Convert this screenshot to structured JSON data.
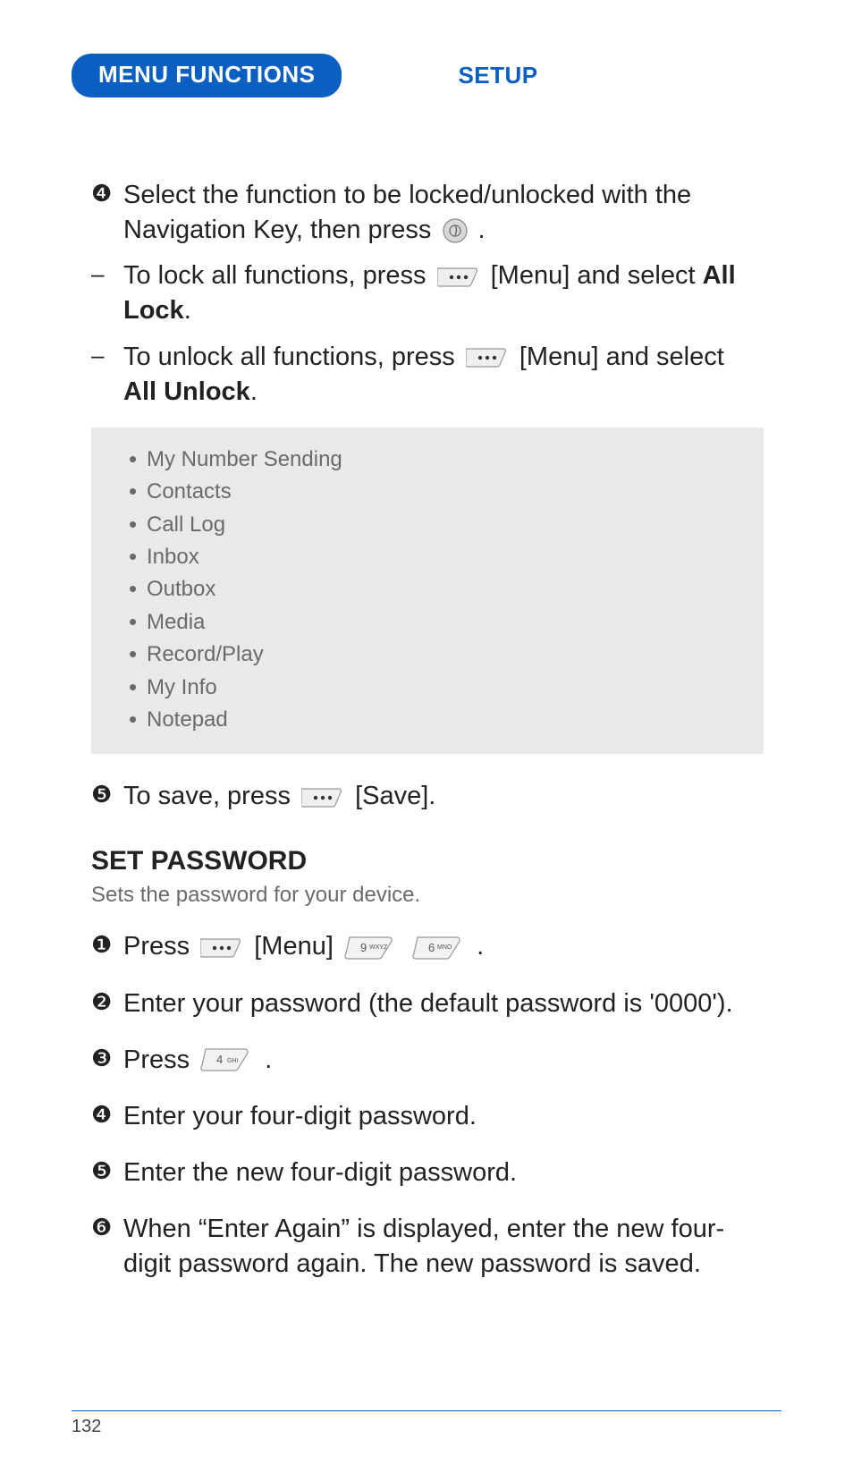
{
  "header": {
    "pill": "MENU FUNCTIONS",
    "section": "SETUP"
  },
  "top": {
    "step4": {
      "marker": "❹",
      "text_a": "Select the function to be locked/unlocked with the Navigation Key, then press ",
      "text_b": " ."
    },
    "dashA": {
      "marker": "–",
      "pre": "To lock all functions, press ",
      "mid": " [Menu] and select ",
      "bold": "All Lock",
      "post": "."
    },
    "dashB": {
      "marker": "–",
      "pre": "To unlock all functions, press ",
      "mid": " [Menu] and select ",
      "bold": "All Unlock",
      "post": "."
    },
    "box_items": [
      "My Number Sending",
      "Contacts",
      "Call Log",
      "Inbox",
      "Outbox",
      "Media",
      "Record/Play",
      "My Info",
      "Notepad"
    ],
    "step5": {
      "marker": "❺",
      "pre": "To save, press ",
      "post": " [Save]."
    }
  },
  "setpw": {
    "title": "SET PASSWORD",
    "sub": "Sets the password for your device.",
    "s1": {
      "marker": "❶",
      "pre": "Press ",
      "mid": " [Menu] ",
      "post": " ."
    },
    "s2": {
      "marker": "❷",
      "text": "Enter your password (the default password is '0000')."
    },
    "s3": {
      "marker": "❸",
      "pre": "Press ",
      "post": " ."
    },
    "s4": {
      "marker": "❹",
      "text": "Enter your four-digit password."
    },
    "s5": {
      "marker": "❺",
      "text": "Enter the new four-digit password."
    },
    "s6": {
      "marker": "❻",
      "text": "When “Enter Again” is displayed, enter the new four-digit password again. The new password is saved."
    }
  },
  "page_number": "132"
}
